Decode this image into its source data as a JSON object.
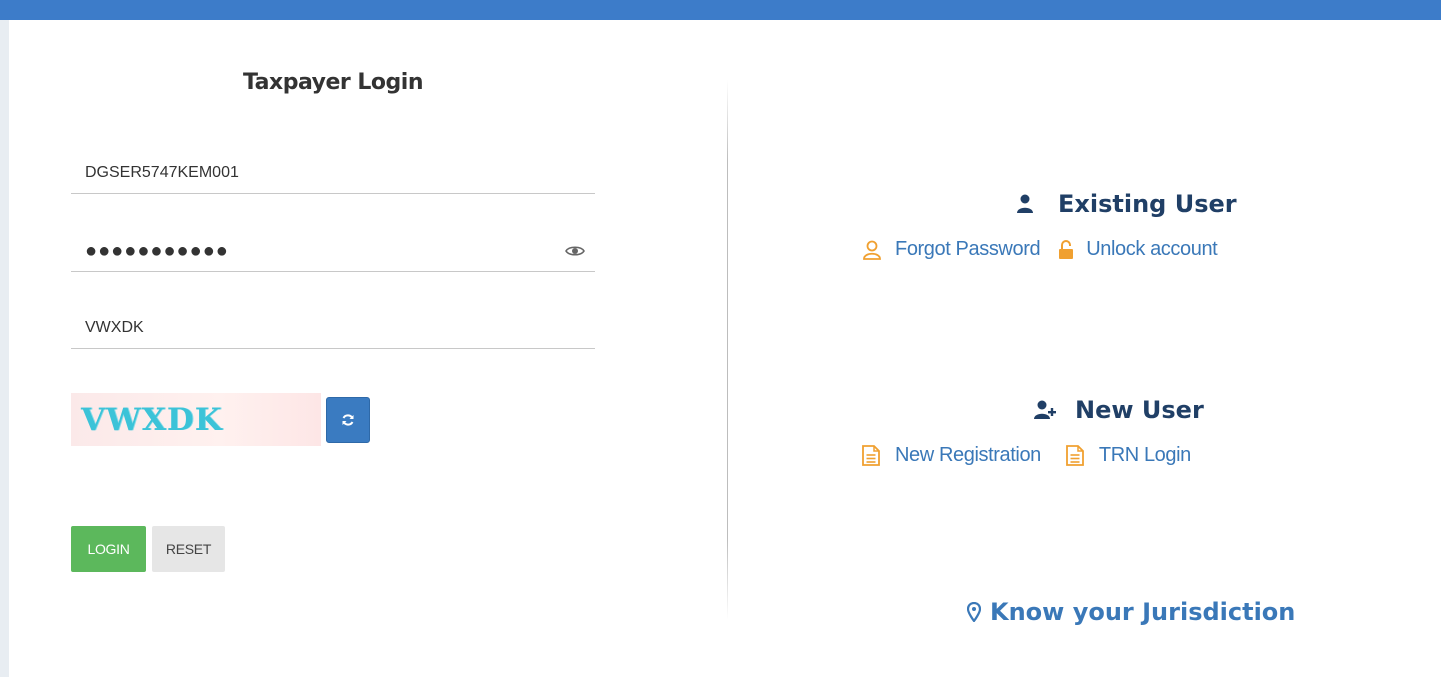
{
  "login": {
    "title": "Taxpayer Login",
    "username_value": "DGSER5747KEM001",
    "password_value": "●●●●●●●●●●●",
    "captcha_input_value": "VWXDK",
    "captcha_image_text": "VWXDK",
    "login_label": "LOGIN",
    "reset_label": "RESET"
  },
  "existing_user": {
    "title": "Existing User",
    "icon": "user-icon",
    "links": [
      {
        "label": "Forgot Password",
        "icon": "user-outline-icon"
      },
      {
        "label": "Unlock account",
        "icon": "unlock-icon"
      }
    ]
  },
  "new_user": {
    "title": "New User",
    "icon": "add-user-icon",
    "links": [
      {
        "label": "New Registration",
        "icon": "document-icon"
      },
      {
        "label": "TRN Login",
        "icon": "document-icon"
      }
    ]
  },
  "jurisdiction": {
    "label": "Know your Jurisdiction",
    "icon": "map-marker-icon"
  },
  "colors": {
    "top_bar": "#3d7cc9",
    "link": "#3a78b8",
    "heading": "#203f66",
    "icon_orange": "#f0a030",
    "login_button": "#5cb85c",
    "refresh_button": "#3a7bc1",
    "captcha_text": "#3cc3d8"
  }
}
